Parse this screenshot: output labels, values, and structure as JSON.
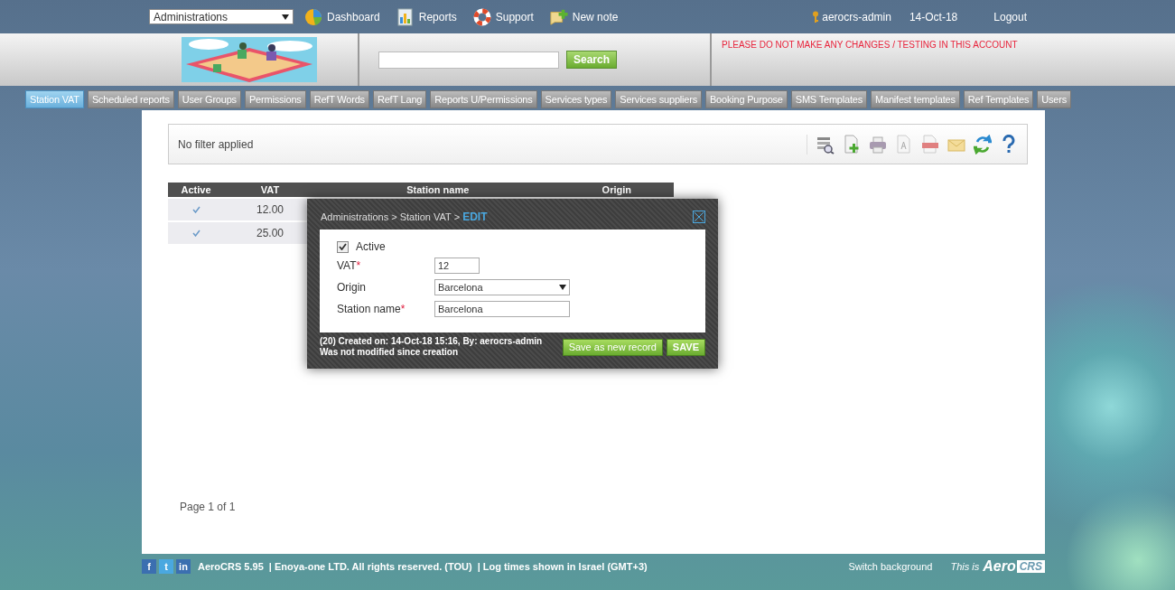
{
  "top_bar": {
    "module_select": {
      "value": "Administrations"
    },
    "nav": [
      {
        "label": "Dashboard",
        "kind": "dashboard"
      },
      {
        "label": "Reports",
        "kind": "reports"
      },
      {
        "label": "Support",
        "kind": "support"
      },
      {
        "label": "New note",
        "kind": "note"
      }
    ],
    "user": "aerocrs-admin",
    "date": "14-Oct-18",
    "logout": "Logout"
  },
  "header": {
    "search_button": "Search",
    "warning": "PLEASE DO NOT MAKE ANY CHANGES / TESTING IN THIS ACCOUNT"
  },
  "tabs": [
    {
      "label": "Station VAT",
      "selected": true
    },
    {
      "label": "Scheduled reports",
      "selected": false
    },
    {
      "label": "User Groups",
      "selected": false
    },
    {
      "label": "Permissions",
      "selected": false
    },
    {
      "label": "RefT Words",
      "selected": false
    },
    {
      "label": "RefT Lang",
      "selected": false
    },
    {
      "label": "Reports U/Permissions",
      "selected": false
    },
    {
      "label": "Services types",
      "selected": false
    },
    {
      "label": "Services suppliers",
      "selected": false
    },
    {
      "label": "Booking Purpose",
      "selected": false
    },
    {
      "label": "SMS Templates",
      "selected": false
    },
    {
      "label": "Manifest templates",
      "selected": false
    },
    {
      "label": "Ref Templates",
      "selected": false
    },
    {
      "label": "Users",
      "selected": false
    }
  ],
  "filter_bar": {
    "text": "No filter applied"
  },
  "table": {
    "columns": [
      "Active",
      "VAT",
      "Station name",
      "Origin"
    ],
    "rows": [
      {
        "active": true,
        "vat": "12.00"
      },
      {
        "active": true,
        "vat": "25.00"
      }
    ]
  },
  "pagination": "Page 1 of 1",
  "modal": {
    "breadcrumb": "Administrations > Station VAT > ",
    "mode": "EDIT",
    "active": {
      "label": "Active",
      "checked": true
    },
    "fields": [
      {
        "label": "VAT",
        "mark": "*",
        "kind": "text",
        "value": "12"
      },
      {
        "label": "Origin",
        "kind": "select",
        "value": "Barcelona"
      },
      {
        "label": "Station name",
        "mark": "*",
        "kind": "text",
        "value": "Barcelona"
      }
    ],
    "info": [
      "(20) Created on: 14-Oct-18 15:16, By: aerocrs-admin",
      "Was not modified since creation"
    ],
    "buttons": [
      "Save as new record",
      "SAVE"
    ]
  },
  "footer": {
    "social": [
      "f",
      "t",
      "in"
    ],
    "text": "AeroCRS 5.95  | Enoya-one LTD. All rights reserved. (TOU)  | Log times shown in Israel (GMT+3)",
    "switch": "Switch background",
    "tagline": "This is",
    "logo": [
      "Aero",
      "CRS"
    ]
  }
}
